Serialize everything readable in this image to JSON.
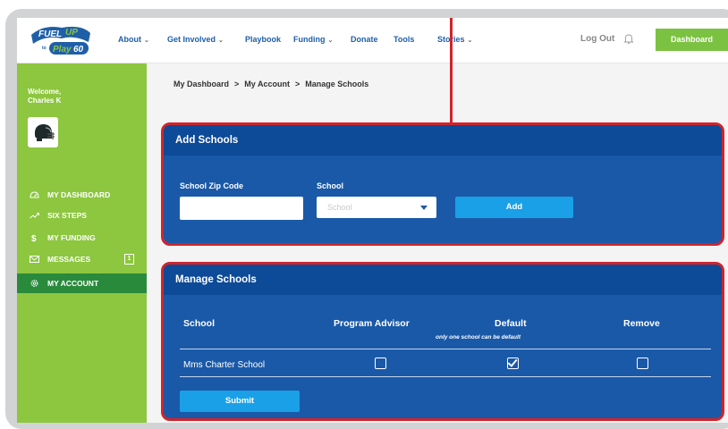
{
  "header": {
    "logo_text_1": "FUEL UP",
    "logo_text_2": "to",
    "logo_text_3": "Play60",
    "nav": [
      {
        "label": "About",
        "has_menu": true
      },
      {
        "label": "Get Involved",
        "has_menu": true
      },
      {
        "label": "Playbook",
        "has_menu": false
      },
      {
        "label": "Funding",
        "has_menu": true
      },
      {
        "label": "Donate",
        "has_menu": false
      },
      {
        "label": "Tools",
        "has_menu": false
      },
      {
        "label": "Stories",
        "has_menu": true
      }
    ],
    "logout_label": "Log Out",
    "dashboard_button": "Dashboard"
  },
  "sidebar": {
    "welcome_line1": "Welcome,",
    "welcome_line2": "Charles K",
    "items": [
      {
        "label": "MY DASHBOARD",
        "icon": "dashboard-icon"
      },
      {
        "label": "SIX STEPS",
        "icon": "trend-icon"
      },
      {
        "label": "MY FUNDING",
        "icon": "dollar-icon"
      },
      {
        "label": "MESSAGES",
        "icon": "envelope-icon",
        "badge": "1"
      },
      {
        "label": "MY ACCOUNT",
        "icon": "gear-icon",
        "active": true
      }
    ]
  },
  "breadcrumb": {
    "items": [
      "My Dashboard",
      "My Account",
      "Manage Schools"
    ],
    "separator": ">"
  },
  "add_schools": {
    "title": "Add Schools",
    "zip_label": "School Zip Code",
    "zip_value": "",
    "school_label": "School",
    "school_placeholder": "School",
    "add_button": "Add"
  },
  "manage_schools": {
    "title": "Manage Schools",
    "columns": [
      "School",
      "Program Advisor",
      "Default",
      "Remove"
    ],
    "default_hint": "only one school can be default",
    "rows": [
      {
        "school": "Mms Charter School",
        "program_advisor": false,
        "default": true,
        "remove": false
      }
    ],
    "submit_button": "Submit"
  },
  "colors": {
    "brand_green": "#8dc63f",
    "active_green": "#2a8a3c",
    "panel_blue": "#1a59a8",
    "button_blue": "#1aa0e6",
    "highlight_red": "#d0242c"
  }
}
